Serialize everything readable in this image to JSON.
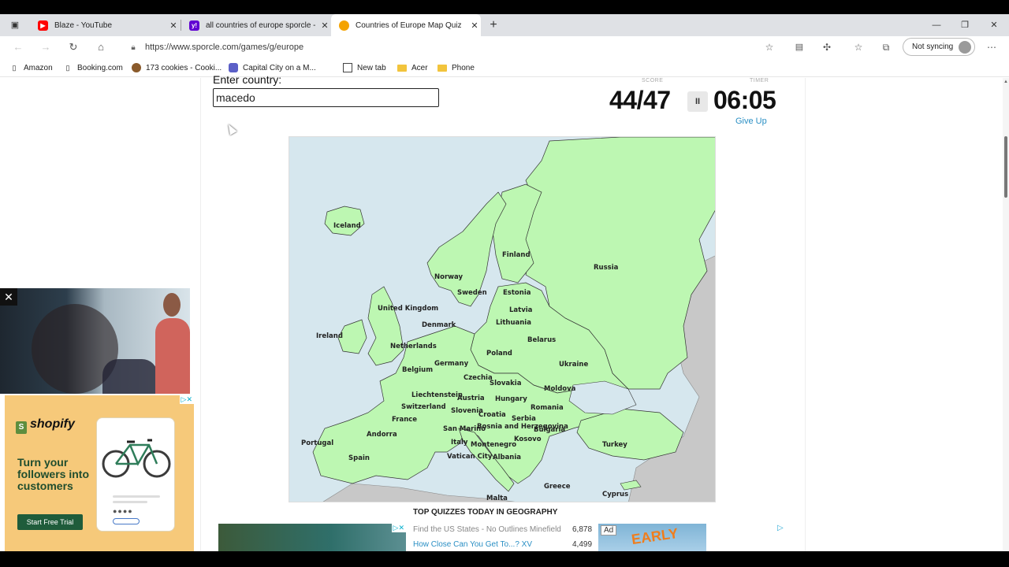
{
  "browser": {
    "tabs": [
      {
        "title": "Blaze - YouTube",
        "favicon": "youtube-icon",
        "color": "#ff0000"
      },
      {
        "title": "all countries of europe sporcle -",
        "favicon": "yahoo-icon",
        "color": "#6001d2"
      },
      {
        "title": "Countries of Europe Map Quiz",
        "favicon": "sporcle-icon",
        "color": "#f4a300"
      }
    ],
    "new_tab_icon": "+",
    "url": "https://www.sporcle.com/games/g/europe",
    "sync_label": "Not syncing",
    "bookmarks": [
      {
        "label": "Amazon",
        "icon": "page-icon"
      },
      {
        "label": "Booking.com",
        "icon": "page-icon"
      },
      {
        "label": "173 cookies - Cooki...",
        "icon": "cookie-icon"
      },
      {
        "label": "Capital City on a M...",
        "icon": "sporcle-icon"
      },
      {
        "label": "New tab",
        "icon": "newtab-icon"
      },
      {
        "label": "Acer",
        "icon": "folder-icon"
      },
      {
        "label": "Phone",
        "icon": "folder-icon"
      }
    ]
  },
  "quiz": {
    "enter_label": "Enter country:",
    "input_value": "macedo",
    "score_label": "SCORE",
    "score": "44/47",
    "timer_label": "TIMER",
    "timer": "06:05",
    "pause_symbol": "II",
    "give_up": "Give Up"
  },
  "map": {
    "colors": {
      "water": "#d6e7ee",
      "country": "#bdf7b2",
      "non_quiz": "#c8c8c8",
      "border": "#333333"
    },
    "labels": [
      "Iceland",
      "Finland",
      "Russia",
      "Norway",
      "Sweden",
      "Estonia",
      "Latvia",
      "United Kingdom",
      "Denmark",
      "Lithuania",
      "Ireland",
      "Netherlands",
      "Belarus",
      "Poland",
      "Germany",
      "Belgium",
      "Ukraine",
      "Czechia",
      "Slovakia",
      "Moldova",
      "Liechtenstein",
      "Austria",
      "Hungary",
      "Switzerland",
      "Slovenia",
      "France",
      "Croatia",
      "Romania",
      "Serbia",
      "San Marino",
      "Bosnia and Herzegovina",
      "Andorra",
      "Bulgaria",
      "Kosovo",
      "Italy",
      "Montenegro",
      "Portugal",
      "Spain",
      "Vatican City",
      "Albania",
      "Turkey",
      "Greece",
      "Malta",
      "Cyprus"
    ]
  },
  "top_quizzes": {
    "heading": "TOP QUIZZES TODAY IN GEOGRAPHY",
    "rows": [
      {
        "title": "Find the US States - No Outlines Minefield",
        "count": "6,878"
      },
      {
        "title": "How Close Can You Get To...? XV",
        "count": "4,499"
      }
    ]
  },
  "ads": {
    "shopify_logo": "shopify",
    "shopify_headline": "Turn your followers into customers",
    "shopify_cta": "Start Free Trial",
    "right_tag": "Ad",
    "right_text": "EARLY",
    "close_x": "✕"
  }
}
